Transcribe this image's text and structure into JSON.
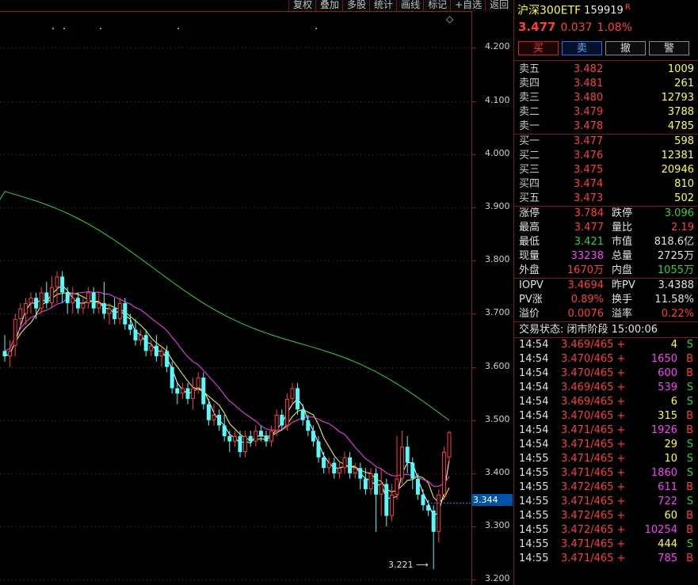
{
  "toolbar": [
    "复权",
    "叠加",
    "多股",
    "统计",
    "画线",
    "标记",
    "+自选",
    "返回"
  ],
  "y_axis": {
    "ticks": [
      "4.200",
      "4.100",
      "4.000",
      "3.900",
      "3.800",
      "3.700",
      "3.600",
      "3.500",
      "3.400",
      "3.300",
      "3.200"
    ]
  },
  "current_price_tag": "3.344",
  "low_marker": "3.221",
  "chart_data": {
    "type": "candlestick",
    "ylim": [
      3.19,
      4.29
    ],
    "ma_colors": [
      "#ffffff",
      "#ffff3c",
      "#ff3cff",
      "#32d232"
    ],
    "candles": [
      [
        3.63,
        3.62,
        3.66,
        3.61
      ],
      [
        3.62,
        3.63,
        3.65,
        3.6
      ],
      [
        3.64,
        3.69,
        3.7,
        3.62
      ],
      [
        3.69,
        3.71,
        3.72,
        3.67
      ],
      [
        3.7,
        3.72,
        3.73,
        3.68
      ],
      [
        3.72,
        3.73,
        3.74,
        3.7
      ],
      [
        3.73,
        3.71,
        3.74,
        3.69
      ],
      [
        3.71,
        3.74,
        3.75,
        3.7
      ],
      [
        3.74,
        3.72,
        3.76,
        3.71
      ],
      [
        3.72,
        3.75,
        3.77,
        3.71
      ],
      [
        3.75,
        3.77,
        3.78,
        3.72
      ],
      [
        3.77,
        3.74,
        3.78,
        3.72
      ],
      [
        3.74,
        3.72,
        3.75,
        3.7
      ],
      [
        3.72,
        3.73,
        3.75,
        3.7
      ],
      [
        3.73,
        3.71,
        3.74,
        3.7
      ],
      [
        3.71,
        3.72,
        3.73,
        3.7
      ],
      [
        3.72,
        3.74,
        3.75,
        3.71
      ],
      [
        3.74,
        3.71,
        3.75,
        3.7
      ],
      [
        3.71,
        3.72,
        3.74,
        3.7
      ],
      [
        3.72,
        3.7,
        3.76,
        3.69
      ],
      [
        3.7,
        3.71,
        3.72,
        3.68
      ],
      [
        3.71,
        3.69,
        3.73,
        3.68
      ],
      [
        3.69,
        3.72,
        3.73,
        3.68
      ],
      [
        3.72,
        3.68,
        3.73,
        3.67
      ],
      [
        3.68,
        3.67,
        3.7,
        3.66
      ],
      [
        3.67,
        3.65,
        3.69,
        3.64
      ],
      [
        3.65,
        3.66,
        3.67,
        3.64
      ],
      [
        3.66,
        3.63,
        3.67,
        3.62
      ],
      [
        3.63,
        3.64,
        3.65,
        3.62
      ],
      [
        3.64,
        3.62,
        3.66,
        3.61
      ],
      [
        3.62,
        3.63,
        3.64,
        3.6
      ],
      [
        3.63,
        3.6,
        3.64,
        3.59
      ],
      [
        3.6,
        3.56,
        3.61,
        3.55
      ],
      [
        3.56,
        3.55,
        3.57,
        3.53
      ],
      [
        3.55,
        3.56,
        3.57,
        3.54
      ],
      [
        3.56,
        3.54,
        3.57,
        3.53
      ],
      [
        3.54,
        3.56,
        3.58,
        3.52
      ],
      [
        3.56,
        3.58,
        3.59,
        3.55
      ],
      [
        3.58,
        3.53,
        3.59,
        3.52
      ],
      [
        3.53,
        3.5,
        3.54,
        3.49
      ],
      [
        3.5,
        3.51,
        3.53,
        3.49
      ],
      [
        3.51,
        3.49,
        3.52,
        3.48
      ],
      [
        3.49,
        3.47,
        3.51,
        3.46
      ],
      [
        3.47,
        3.46,
        3.48,
        3.44
      ],
      [
        3.46,
        3.47,
        3.48,
        3.45
      ],
      [
        3.47,
        3.44,
        3.48,
        3.43
      ],
      [
        3.44,
        3.47,
        3.48,
        3.43
      ],
      [
        3.47,
        3.46,
        3.48,
        3.45
      ],
      [
        3.46,
        3.48,
        3.49,
        3.45
      ],
      [
        3.48,
        3.47,
        3.49,
        3.46
      ],
      [
        3.47,
        3.46,
        3.48,
        3.45
      ],
      [
        3.46,
        3.48,
        3.49,
        3.45
      ],
      [
        3.48,
        3.51,
        3.52,
        3.47
      ],
      [
        3.51,
        3.49,
        3.52,
        3.48
      ],
      [
        3.49,
        3.54,
        3.55,
        3.48
      ],
      [
        3.54,
        3.56,
        3.57,
        3.53
      ],
      [
        3.56,
        3.52,
        3.57,
        3.51
      ],
      [
        3.52,
        3.5,
        3.53,
        3.49
      ],
      [
        3.5,
        3.48,
        3.51,
        3.47
      ],
      [
        3.48,
        3.46,
        3.49,
        3.45
      ],
      [
        3.46,
        3.43,
        3.47,
        3.42
      ],
      [
        3.43,
        3.41,
        3.44,
        3.4
      ],
      [
        3.41,
        3.42,
        3.43,
        3.4
      ],
      [
        3.42,
        3.4,
        3.43,
        3.39
      ],
      [
        3.4,
        3.41,
        3.42,
        3.39
      ],
      [
        3.41,
        3.43,
        3.44,
        3.4
      ],
      [
        3.43,
        3.4,
        3.44,
        3.39
      ],
      [
        3.4,
        3.41,
        3.42,
        3.39
      ],
      [
        3.41,
        3.39,
        3.42,
        3.37
      ],
      [
        3.39,
        3.37,
        3.41,
        3.36
      ],
      [
        3.37,
        3.4,
        3.41,
        3.36
      ],
      [
        3.4,
        3.36,
        3.41,
        3.29
      ],
      [
        3.36,
        3.38,
        3.41,
        3.32
      ],
      [
        3.38,
        3.32,
        3.39,
        3.3
      ],
      [
        3.32,
        3.36,
        3.38,
        3.31
      ],
      [
        3.36,
        3.39,
        3.47,
        3.35
      ],
      [
        3.39,
        3.45,
        3.48,
        3.38
      ],
      [
        3.45,
        3.42,
        3.47,
        3.4
      ],
      [
        3.42,
        3.39,
        3.43,
        3.37
      ],
      [
        3.39,
        3.36,
        3.4,
        3.35
      ],
      [
        3.36,
        3.34,
        3.37,
        3.33
      ],
      [
        3.34,
        3.33,
        3.35,
        3.32
      ],
      [
        3.33,
        3.29,
        3.34,
        3.22
      ],
      [
        3.29,
        3.36,
        3.37,
        3.27
      ],
      [
        3.36,
        3.44,
        3.45,
        3.35
      ],
      [
        3.43,
        3.477,
        3.48,
        3.42
      ]
    ]
  },
  "panel": {
    "name": "沪深300ETF",
    "code": "159919",
    "badge": "R",
    "price": "3.477",
    "change": "0.037",
    "change_pct": "1.08%",
    "buttons": [
      "买",
      "卖",
      "撤",
      "警"
    ],
    "asks": [
      {
        "label": "卖五",
        "price": "3.482",
        "vol": "1009"
      },
      {
        "label": "卖四",
        "price": "3.481",
        "vol": "261"
      },
      {
        "label": "卖三",
        "price": "3.480",
        "vol": "12793"
      },
      {
        "label": "卖二",
        "price": "3.479",
        "vol": "3788"
      },
      {
        "label": "卖一",
        "price": "3.478",
        "vol": "4785"
      }
    ],
    "bids": [
      {
        "label": "买一",
        "price": "3.477",
        "vol": "598"
      },
      {
        "label": "买二",
        "price": "3.476",
        "vol": "12381"
      },
      {
        "label": "买三",
        "price": "3.475",
        "vol": "20946"
      },
      {
        "label": "买四",
        "price": "3.474",
        "vol": "810"
      },
      {
        "label": "买五",
        "price": "3.473",
        "vol": "502"
      }
    ],
    "stats": [
      {
        "l1": "涨停",
        "v1": "3.784",
        "c1": "rd",
        "l2": "跌停",
        "v2": "3.096",
        "c2": "gr"
      },
      {
        "l1": "最高",
        "v1": "3.477",
        "c1": "rd",
        "l2": "量比",
        "v2": "2.19",
        "c2": "rd"
      },
      {
        "l1": "最低",
        "v1": "3.421",
        "c1": "gr",
        "l2": "市值",
        "v2": "818.6亿",
        "c2": "wh"
      },
      {
        "l1": "现量",
        "v1": "33238",
        "c1": "mg",
        "l2": "总量",
        "v2": "2725万",
        "c2": "wh"
      },
      {
        "l1": "外盘",
        "v1": "1670万",
        "c1": "rd",
        "l2": "内盘",
        "v2": "1055万",
        "c2": "gr"
      }
    ],
    "stats2": [
      {
        "l1": "IOPV",
        "v1": "3.4694",
        "c1": "rd",
        "l2": "昨PV",
        "v2": "3.4388",
        "c2": "wh"
      },
      {
        "l1": "PV涨",
        "v1": "0.89%",
        "c1": "rd",
        "l2": "换手",
        "v2": "11.58%",
        "c2": "wh"
      },
      {
        "l1": "溢价",
        "v1": "0.0076",
        "c1": "rd",
        "l2": "溢率",
        "v2": "0.22%",
        "c2": "rd"
      }
    ],
    "status": "交易状态: 闭市阶段 15:00:06",
    "trades": [
      {
        "t": "14:54",
        "p": "3.469/465 +",
        "v": "4",
        "vc": "yl",
        "s": "S",
        "sc": "gr"
      },
      {
        "t": "14:54",
        "p": "3.470/465 +",
        "v": "1650",
        "vc": "mg",
        "s": "B",
        "sc": "rd"
      },
      {
        "t": "14:54",
        "p": "3.470/465 +",
        "v": "600",
        "vc": "mg",
        "s": "B",
        "sc": "rd"
      },
      {
        "t": "14:54",
        "p": "3.469/465 +",
        "v": "539",
        "vc": "mg",
        "s": "S",
        "sc": "gr"
      },
      {
        "t": "14:54",
        "p": "3.469/465 +",
        "v": "6",
        "vc": "yl",
        "s": "S",
        "sc": "gr"
      },
      {
        "t": "14:54",
        "p": "3.470/465 +",
        "v": "315",
        "vc": "yl",
        "s": "B",
        "sc": "rd"
      },
      {
        "t": "14:54",
        "p": "3.471/465 +",
        "v": "1926",
        "vc": "mg",
        "s": "B",
        "sc": "rd"
      },
      {
        "t": "14:54",
        "p": "3.471/465 +",
        "v": "29",
        "vc": "yl",
        "s": "S",
        "sc": "gr"
      },
      {
        "t": "14:55",
        "p": "3.471/465 +",
        "v": "10",
        "vc": "yl",
        "s": "S",
        "sc": "gr"
      },
      {
        "t": "14:55",
        "p": "3.471/465 +",
        "v": "1860",
        "vc": "mg",
        "s": "S",
        "sc": "gr"
      },
      {
        "t": "14:55",
        "p": "3.472/465 +",
        "v": "611",
        "vc": "mg",
        "s": "B",
        "sc": "rd"
      },
      {
        "t": "14:55",
        "p": "3.471/465 +",
        "v": "722",
        "vc": "mg",
        "s": "S",
        "sc": "gr"
      },
      {
        "t": "14:55",
        "p": "3.472/465 +",
        "v": "60",
        "vc": "yl",
        "s": "B",
        "sc": "rd"
      },
      {
        "t": "14:55",
        "p": "3.472/465 +",
        "v": "10254",
        "vc": "mg",
        "s": "B",
        "sc": "rd"
      },
      {
        "t": "14:55",
        "p": "3.471/465 +",
        "v": "444",
        "vc": "yl",
        "s": "S",
        "sc": "gr"
      },
      {
        "t": "14:55",
        "p": "3.471/465 +",
        "v": "785",
        "vc": "mg",
        "s": "B",
        "sc": "rd"
      }
    ]
  }
}
